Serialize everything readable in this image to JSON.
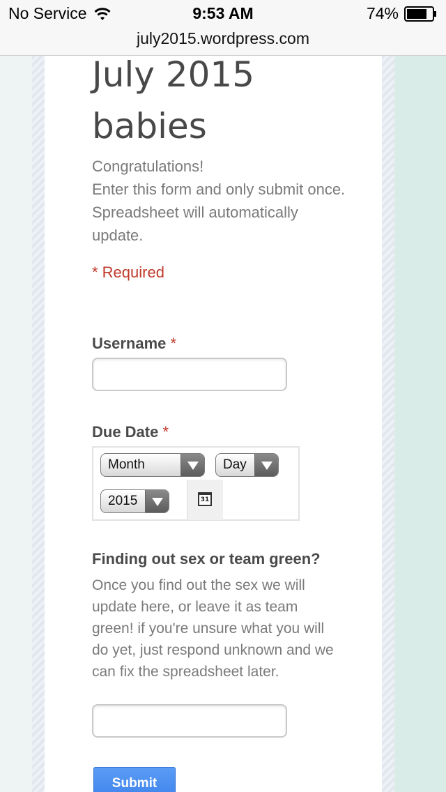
{
  "status_bar": {
    "carrier": "No Service",
    "time": "9:53 AM",
    "battery": "74%"
  },
  "browser": {
    "url": "july2015.wordpress.com"
  },
  "form": {
    "title": "July 2015 babies",
    "description_lines": [
      "Congratulations!",
      "Enter this form and only submit once.  Spreadsheet will automatically update."
    ],
    "required_note": "* Required",
    "username": {
      "label": "Username",
      "required_mark": "*",
      "value": ""
    },
    "due_date": {
      "label": "Due Date",
      "required_mark": "*",
      "month_value": "Month",
      "day_value": "Day",
      "year_value": "2015",
      "calendar_text": "31"
    },
    "sex": {
      "label": "Finding out sex or team green?",
      "help": "Once you find out the sex we will update here, or leave it as team green! if you're unsure what you will do yet, just respond unknown and we can fix the spreadsheet later.",
      "value": ""
    },
    "submit_label": "Submit"
  },
  "colors": {
    "required_red": "#c0392b",
    "submit_blue": "#3d82ec",
    "right_gutter": "#d9ece8"
  }
}
